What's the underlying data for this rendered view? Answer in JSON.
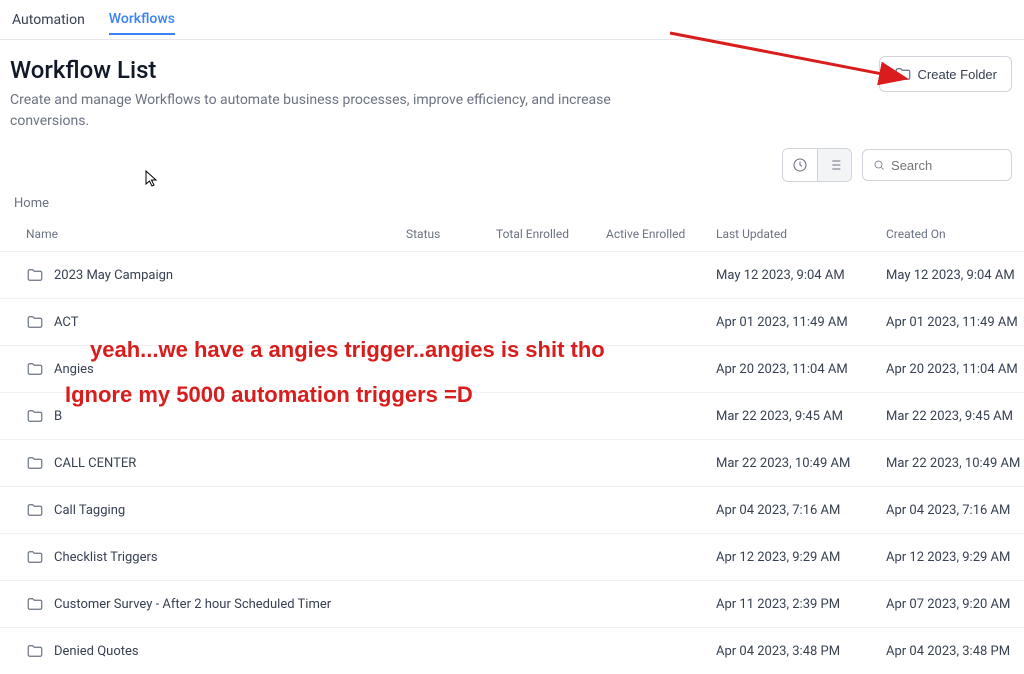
{
  "tabs": {
    "automation": "Automation",
    "workflows": "Workflows"
  },
  "header": {
    "title": "Workflow List",
    "description": "Create and manage Workflows to automate business processes, improve efficiency, and increase conversions.",
    "create_folder": "Create Folder"
  },
  "search": {
    "placeholder": "Search"
  },
  "breadcrumb": {
    "home": "Home"
  },
  "columns": {
    "name": "Name",
    "status": "Status",
    "total_enrolled": "Total Enrolled",
    "active_enrolled": "Active Enrolled",
    "last_updated": "Last Updated",
    "created_on": "Created On"
  },
  "rows": [
    {
      "name": "2023 May Campaign",
      "last_updated": "May 12 2023, 9:04 AM",
      "created_on": "May 12 2023, 9:04 AM"
    },
    {
      "name": "ACT",
      "last_updated": "Apr 01 2023, 11:49 AM",
      "created_on": "Apr 01 2023, 11:49 AM"
    },
    {
      "name": "Angies",
      "last_updated": "Apr 20 2023, 11:04 AM",
      "created_on": "Apr 20 2023, 11:04 AM"
    },
    {
      "name": "B",
      "last_updated": "Mar 22 2023, 9:45 AM",
      "created_on": "Mar 22 2023, 9:45 AM"
    },
    {
      "name": "CALL CENTER",
      "last_updated": "Mar 22 2023, 10:49 AM",
      "created_on": "Mar 22 2023, 10:49 AM"
    },
    {
      "name": "Call Tagging",
      "last_updated": "Apr 04 2023, 7:16 AM",
      "created_on": "Apr 04 2023, 7:16 AM"
    },
    {
      "name": "Checklist Triggers",
      "last_updated": "Apr 12 2023, 9:29 AM",
      "created_on": "Apr 12 2023, 9:29 AM"
    },
    {
      "name": "Customer Survey - After 2 hour Scheduled Timer",
      "last_updated": "Apr 11 2023, 2:39 PM",
      "created_on": "Apr 07 2023, 9:20 AM"
    },
    {
      "name": "Denied Quotes",
      "last_updated": "Apr 04 2023, 3:48 PM",
      "created_on": "Apr 04 2023, 3:48 PM"
    }
  ],
  "annotations": {
    "line1": "yeah...we have a angies trigger..angies is shit tho",
    "line2": "Ignore my 5000 automation triggers =D"
  }
}
